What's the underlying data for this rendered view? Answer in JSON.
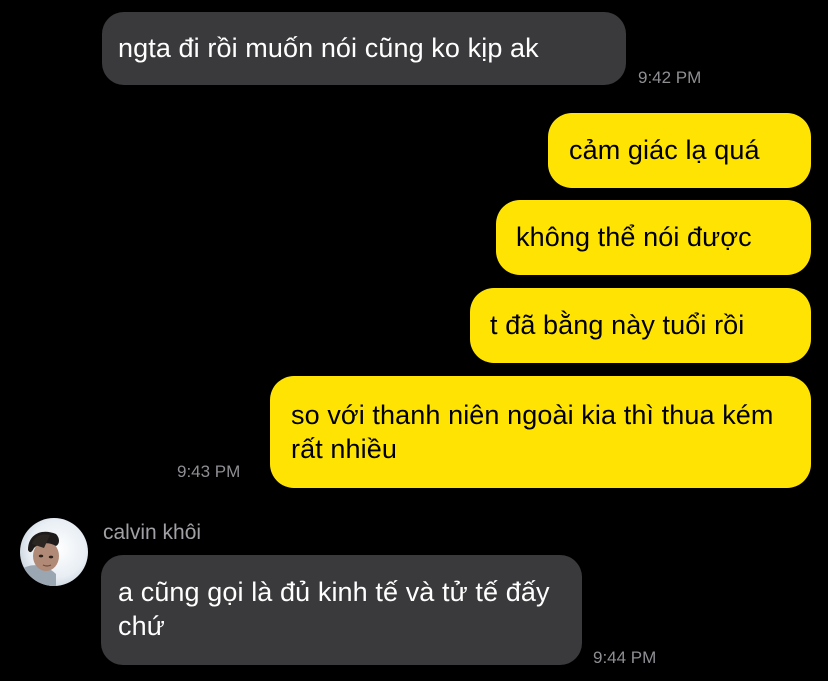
{
  "messages": [
    {
      "direction": "in",
      "text": "ngta đi rồi muốn nói cũng ko kịp ak",
      "time": "9:42 PM"
    },
    {
      "direction": "out",
      "text": "cảm giác lạ quá"
    },
    {
      "direction": "out",
      "text": "không thể nói được"
    },
    {
      "direction": "out",
      "text": "t đã bằng này tuổi rồi"
    },
    {
      "direction": "out",
      "text": "so với thanh niên ngoài kia thì thua kém rất nhiều",
      "time": "9:43 PM"
    },
    {
      "direction": "in",
      "sender": "calvin khôi",
      "text": "a cũng gọi là đủ kinh tế và tử tế đấy chứ",
      "time": "9:44 PM",
      "avatar_icon": "contact-photo"
    }
  ],
  "colors": {
    "background": "#000000",
    "incoming_bubble": "#3a3a3c",
    "outgoing_bubble": "#ffe403",
    "timestamp": "#8e8e93"
  }
}
